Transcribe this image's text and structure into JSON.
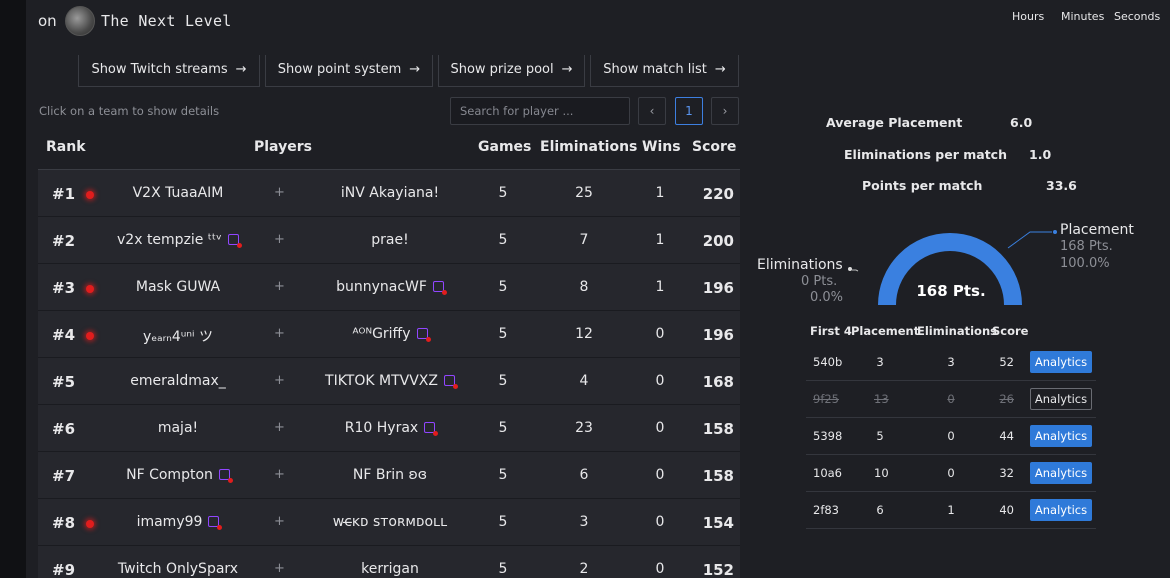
{
  "header": {
    "on_label": "on",
    "title": "The Next Level",
    "timer_labels": [
      "Hours",
      "Minutes",
      "Seconds"
    ]
  },
  "buttons": [
    {
      "label": "Show Twitch streams",
      "arrow": "→"
    },
    {
      "label": "Show point system",
      "arrow": "→"
    },
    {
      "label": "Show prize pool",
      "arrow": "→"
    },
    {
      "label": "Show match list",
      "arrow": "→"
    }
  ],
  "hint": "Click on a team to show details",
  "search": {
    "placeholder": "Search for player ..."
  },
  "pagination": {
    "prev": "‹",
    "current": "1",
    "next": "›"
  },
  "table": {
    "headers": {
      "rank": "Rank",
      "players": "Players",
      "games": "Games",
      "eliminations": "Eliminations",
      "wins": "Wins",
      "score": "Score"
    },
    "plus": "+",
    "rows": [
      {
        "rank": "#1",
        "live": true,
        "p1": "V2X TuaaAIM",
        "p1_twitch": false,
        "p2": "iNV Akayiana!",
        "p2_twitch": false,
        "games": "5",
        "elims": "25",
        "wins": "1",
        "score": "220"
      },
      {
        "rank": "#2",
        "live": false,
        "p1": "v2x tempzie ᵗᵗᵛ",
        "p1_twitch": true,
        "p2": "prae!",
        "p2_twitch": false,
        "games": "5",
        "elims": "7",
        "wins": "1",
        "score": "200"
      },
      {
        "rank": "#3",
        "live": true,
        "p1": "Mask GUWA",
        "p1_twitch": false,
        "p2": "bunnynacWF",
        "p2_twitch": true,
        "games": "5",
        "elims": "8",
        "wins": "1",
        "score": "196"
      },
      {
        "rank": "#4",
        "live": true,
        "p1": "yₑₐᵣₙ4ᵘⁿⁱ ツ",
        "p1_twitch": false,
        "p2": "ᴬᴼᴺGriffy",
        "p2_twitch": true,
        "games": "5",
        "elims": "12",
        "wins": "0",
        "score": "196"
      },
      {
        "rank": "#5",
        "live": false,
        "p1": "emeraldmax_",
        "p1_twitch": false,
        "p2": "TIKTOK MTVVXZ",
        "p2_twitch": true,
        "games": "5",
        "elims": "4",
        "wins": "0",
        "score": "168"
      },
      {
        "rank": "#6",
        "live": false,
        "p1": "maja!",
        "p1_twitch": false,
        "p2": "R10 Hyrax",
        "p2_twitch": true,
        "games": "5",
        "elims": "23",
        "wins": "0",
        "score": "158"
      },
      {
        "rank": "#7",
        "live": false,
        "p1": "NF Compton",
        "p1_twitch": true,
        "p2": "NF Brin ʚɞ",
        "p2_twitch": false,
        "games": "5",
        "elims": "6",
        "wins": "0",
        "score": "158"
      },
      {
        "rank": "#8",
        "live": true,
        "p1": "imamy99",
        "p1_twitch": true,
        "p2": "wᴄ̶ᴋᴅ sᴛᴏʀᴍᴅᴏʟʟ",
        "p2_twitch": false,
        "games": "5",
        "elims": "3",
        "wins": "0",
        "score": "154"
      },
      {
        "rank": "#9",
        "live": false,
        "p1": "Twitch OnlySparx",
        "p1_twitch": false,
        "p2": "kerrigan",
        "p2_twitch": false,
        "games": "5",
        "elims": "2",
        "wins": "0",
        "score": "152"
      }
    ]
  },
  "stats": {
    "avg_placement_label": "Average Placement",
    "avg_placement": "6.0",
    "elims_per_match_label": "Eliminations per match",
    "elims_per_match": "1.0",
    "points_per_match_label": "Points per match",
    "points_per_match": "33.6"
  },
  "gauge": {
    "center": "168 Pts.",
    "placement_label": "Placement",
    "placement_pts": "168 Pts.",
    "placement_pct": "100.0%",
    "elims_label": "Eliminations",
    "elims_pts": "0 Pts.",
    "elims_pct": "0.0%",
    "placement_fraction": 1.0,
    "arc_color": "#3a80e0"
  },
  "matches": {
    "headers": {
      "first": "First 4",
      "placement": "Placement",
      "eliminations": "Eliminations",
      "score": "Score"
    },
    "rows": [
      {
        "id": "540b",
        "placement": "3",
        "elims": "3",
        "score": "52",
        "button": "Analytics",
        "struck": false
      },
      {
        "id": "9f25",
        "placement": "13",
        "elims": "0",
        "score": "26",
        "button": "Analytics",
        "struck": true
      },
      {
        "id": "5398",
        "placement": "5",
        "elims": "0",
        "score": "44",
        "button": "Analytics",
        "struck": false
      },
      {
        "id": "10a6",
        "placement": "10",
        "elims": "0",
        "score": "32",
        "button": "Analytics",
        "struck": false
      },
      {
        "id": "2f83",
        "placement": "6",
        "elims": "1",
        "score": "40",
        "button": "Analytics",
        "struck": false
      }
    ]
  }
}
